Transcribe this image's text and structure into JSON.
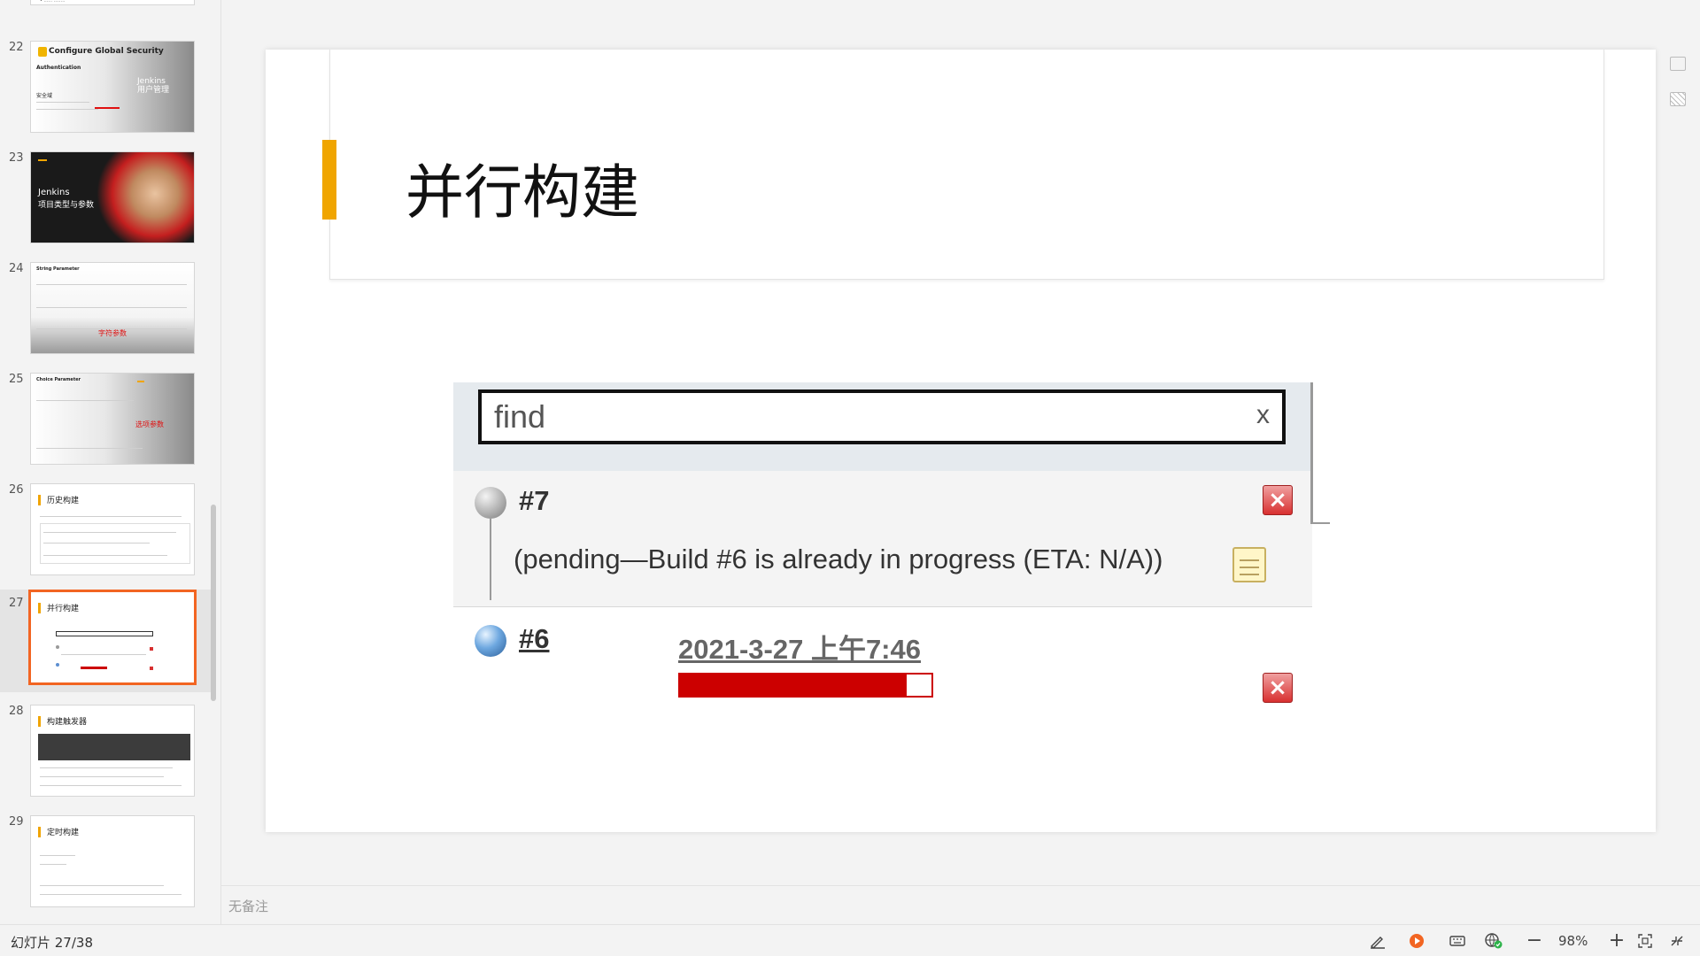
{
  "thumbnails": [
    {
      "number": "",
      "title": "",
      "sub1": "",
      "sub2": ""
    },
    {
      "number": "22",
      "title": "Configure Global Security",
      "heading": "Authentication",
      "sub": "安全域",
      "overlay": "Jenkins\n用户管理"
    },
    {
      "number": "23",
      "title": "Jenkins",
      "sub": "项目类型与参数"
    },
    {
      "number": "24",
      "title": "String Parameter",
      "overlay": "字符参数"
    },
    {
      "number": "25",
      "title": "Choice Parameter",
      "overlay": "选项参数"
    },
    {
      "number": "26",
      "title": "历史构建"
    },
    {
      "number": "27",
      "title": "并行构建"
    },
    {
      "number": "28",
      "title": "构建触发器"
    },
    {
      "number": "29",
      "title": "定时构建"
    }
  ],
  "slide": {
    "title": "并行构建",
    "jenkins": {
      "search_placeholder": "find",
      "clear_label": "x",
      "pending_build": {
        "number": "#7",
        "text": "(pending—Build #6 is already in progress (ETA: N/A))"
      },
      "running_build": {
        "number": "#6",
        "date": "2021-3-27 上午7:46",
        "progress": 0.9
      }
    }
  },
  "notes": {
    "placeholder": "无备注"
  },
  "statusbar": {
    "slide_counter": "幻灯片 27/38",
    "zoom": "98%",
    "zoom_out": "−",
    "zoom_in": "+"
  },
  "colors": {
    "accent": "#f0a500",
    "active_thumb_border": "#f26522",
    "progress": "#cc0000"
  },
  "icons": [
    "pen-icon",
    "play-icon",
    "keyboard-icon",
    "globe-check-icon",
    "fit-screen-icon",
    "collapse-icon",
    "layout-icon",
    "hatch-icon"
  ]
}
